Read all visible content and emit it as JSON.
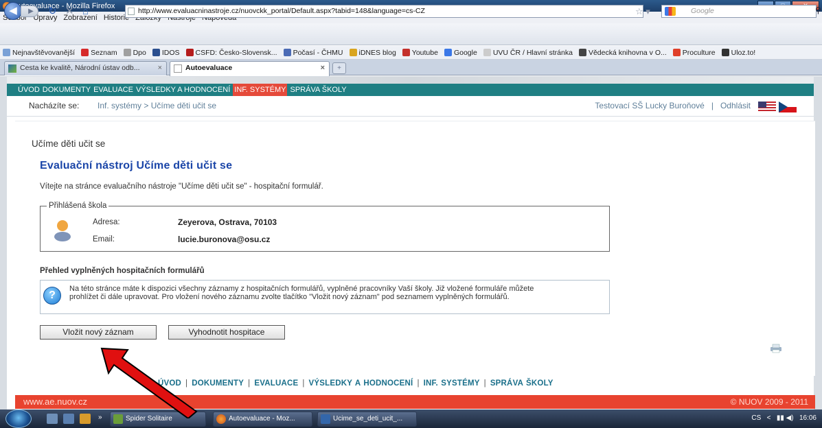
{
  "window": {
    "title": "Autoevaluace - Mozilla Firefox"
  },
  "menubar": [
    "Soubor",
    "Úpravy",
    "Zobrazení",
    "Historie",
    "Záložky",
    "Nástroje",
    "Nápověda"
  ],
  "nav": {
    "url": "http://www.evaluacninastroje.cz/nuovckk_portal/Default.aspx?tabid=148&language=cs-CZ",
    "search_placeholder": "Google"
  },
  "bookmarks": [
    {
      "label": "Nejnavštěvovanější",
      "color": "#7aa1d6"
    },
    {
      "label": "Seznam",
      "color": "#d62b2b"
    },
    {
      "label": "Dpo",
      "color": "#a0a0a0"
    },
    {
      "label": "IDOS",
      "color": "#2b4f8f"
    },
    {
      "label": "CSFD: Česko-Slovensk...",
      "color": "#b51c1c"
    },
    {
      "label": "Počasí - ČHMU",
      "color": "#4b6bb5"
    },
    {
      "label": "iDNES blog",
      "color": "#d9a520"
    },
    {
      "label": "Youtube",
      "color": "#c4302b"
    },
    {
      "label": "Google",
      "color": "#3b78e7"
    },
    {
      "label": "UVU ČR / Hlavní stránka",
      "color": "#cccccc"
    },
    {
      "label": "Vědecká knihovna v O...",
      "color": "#444444"
    },
    {
      "label": "Proculture",
      "color": "#e0402a"
    },
    {
      "label": "Uloz.to!",
      "color": "#333333"
    }
  ],
  "tabs": [
    {
      "label": "Cesta ke kvalitě, Národní ústav odb...",
      "close": "×"
    },
    {
      "label": "Autoevaluace",
      "close": "×"
    }
  ],
  "site": {
    "menu": [
      "ÚVOD",
      "DOKUMENTY",
      "EVALUACE",
      "VÝSLEDKY A HODNOCENÍ",
      "INF. SYSTÉMY",
      "SPRÁVA ŠKOLY"
    ],
    "active_menu": "INF. SYSTÉMY",
    "breadcrumb_label": "Nacházíte se:",
    "breadcrumb_path": "Inf. systémy > Učíme děti učit se",
    "user_name": "Testovací SŠ Lucky Buroňové",
    "separator": "|",
    "logout": "Odhlásit",
    "section_title": "Učíme děti učit se",
    "tool_title": "Evaluační nástroj Učíme děti učit se",
    "welcome": "Vítejte na stránce evaluačního nástroje \"Učíme děti učit se\" - hospitační formulář.",
    "school_legend": "Přihlášená škola",
    "address_label": "Adresa:",
    "address_value": "Zeyerova, Ostrava, 70103",
    "email_label": "Email:",
    "email_value": "lucie.buronova@osu.cz",
    "overview_title": "Přehled vyplněných hospitačních formulářů",
    "info_text": "Na této stránce máte k dispozici všechny záznamy z hospitačních formulářů, vyplněné pracovníky Vaší školy. Již vložené formuláře můžete prohlížet či dále upravovat. Pro vložení nového záznamu zvolte tlačítko \"Vložit nový záznam\" pod seznamem vyplněných formulářů.",
    "btn_new": "Vložit nový záznam",
    "btn_eval": "Vyhodnotit hospitace",
    "footer_nav": [
      "ÚVOD",
      "DOKUMENTY",
      "EVALUACE",
      "VÝSLEDKY A HODNOCENÍ",
      "INF. SYSTÉMY",
      "SPRÁVA ŠKOLY"
    ],
    "footer_left": "www.ae.nuov.cz",
    "footer_right": "© NUOV 2009 - 2011"
  },
  "taskbar": {
    "tasks": [
      "Spider Solitaire",
      "Autoevaluace - Moz...",
      "Ucime_se_deti_ucit_..."
    ],
    "lang": "CS",
    "time": "16:06"
  }
}
